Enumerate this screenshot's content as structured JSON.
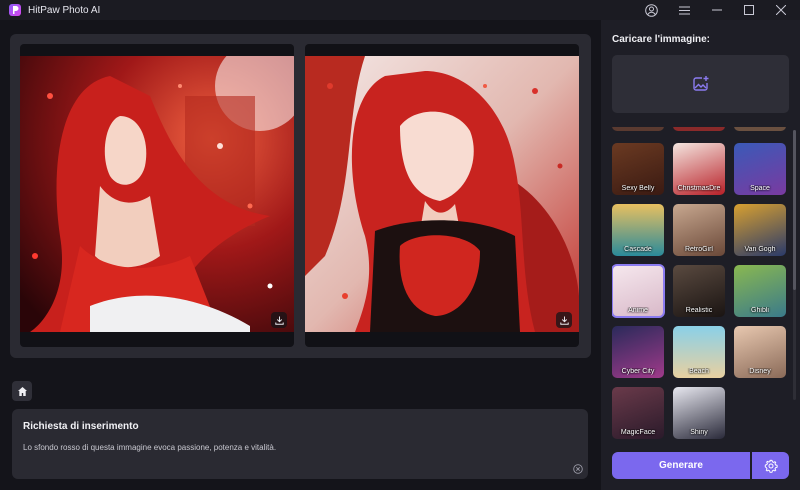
{
  "app": {
    "title": "HitPaw Photo AI",
    "accent": "#7b68ee"
  },
  "upload": {
    "label": "Caricare l'immagine:",
    "icon": "image-plus-icon"
  },
  "styles": [
    {
      "label": "Sexy Belly",
      "selected": false
    },
    {
      "label": "ChristmasDre",
      "selected": false
    },
    {
      "label": "Space",
      "selected": false
    },
    {
      "label": "Cascade",
      "selected": false
    },
    {
      "label": "RetroGirl",
      "selected": false
    },
    {
      "label": "Van Gogh",
      "selected": false
    },
    {
      "label": "Anime",
      "selected": true
    },
    {
      "label": "Realistic",
      "selected": false
    },
    {
      "label": "Ghibli",
      "selected": false
    },
    {
      "label": "Cyber City",
      "selected": false
    },
    {
      "label": "Beach",
      "selected": false
    },
    {
      "label": "Disney",
      "selected": false
    },
    {
      "label": "MagicFace",
      "selected": false
    },
    {
      "label": "Shiny",
      "selected": false
    }
  ],
  "prompt": {
    "title": "Richiesta di inserimento",
    "text": "Lo sfondo rosso di questa immagine evoca passione, potenza e vitalità."
  },
  "actions": {
    "generate_label": "Generare"
  }
}
